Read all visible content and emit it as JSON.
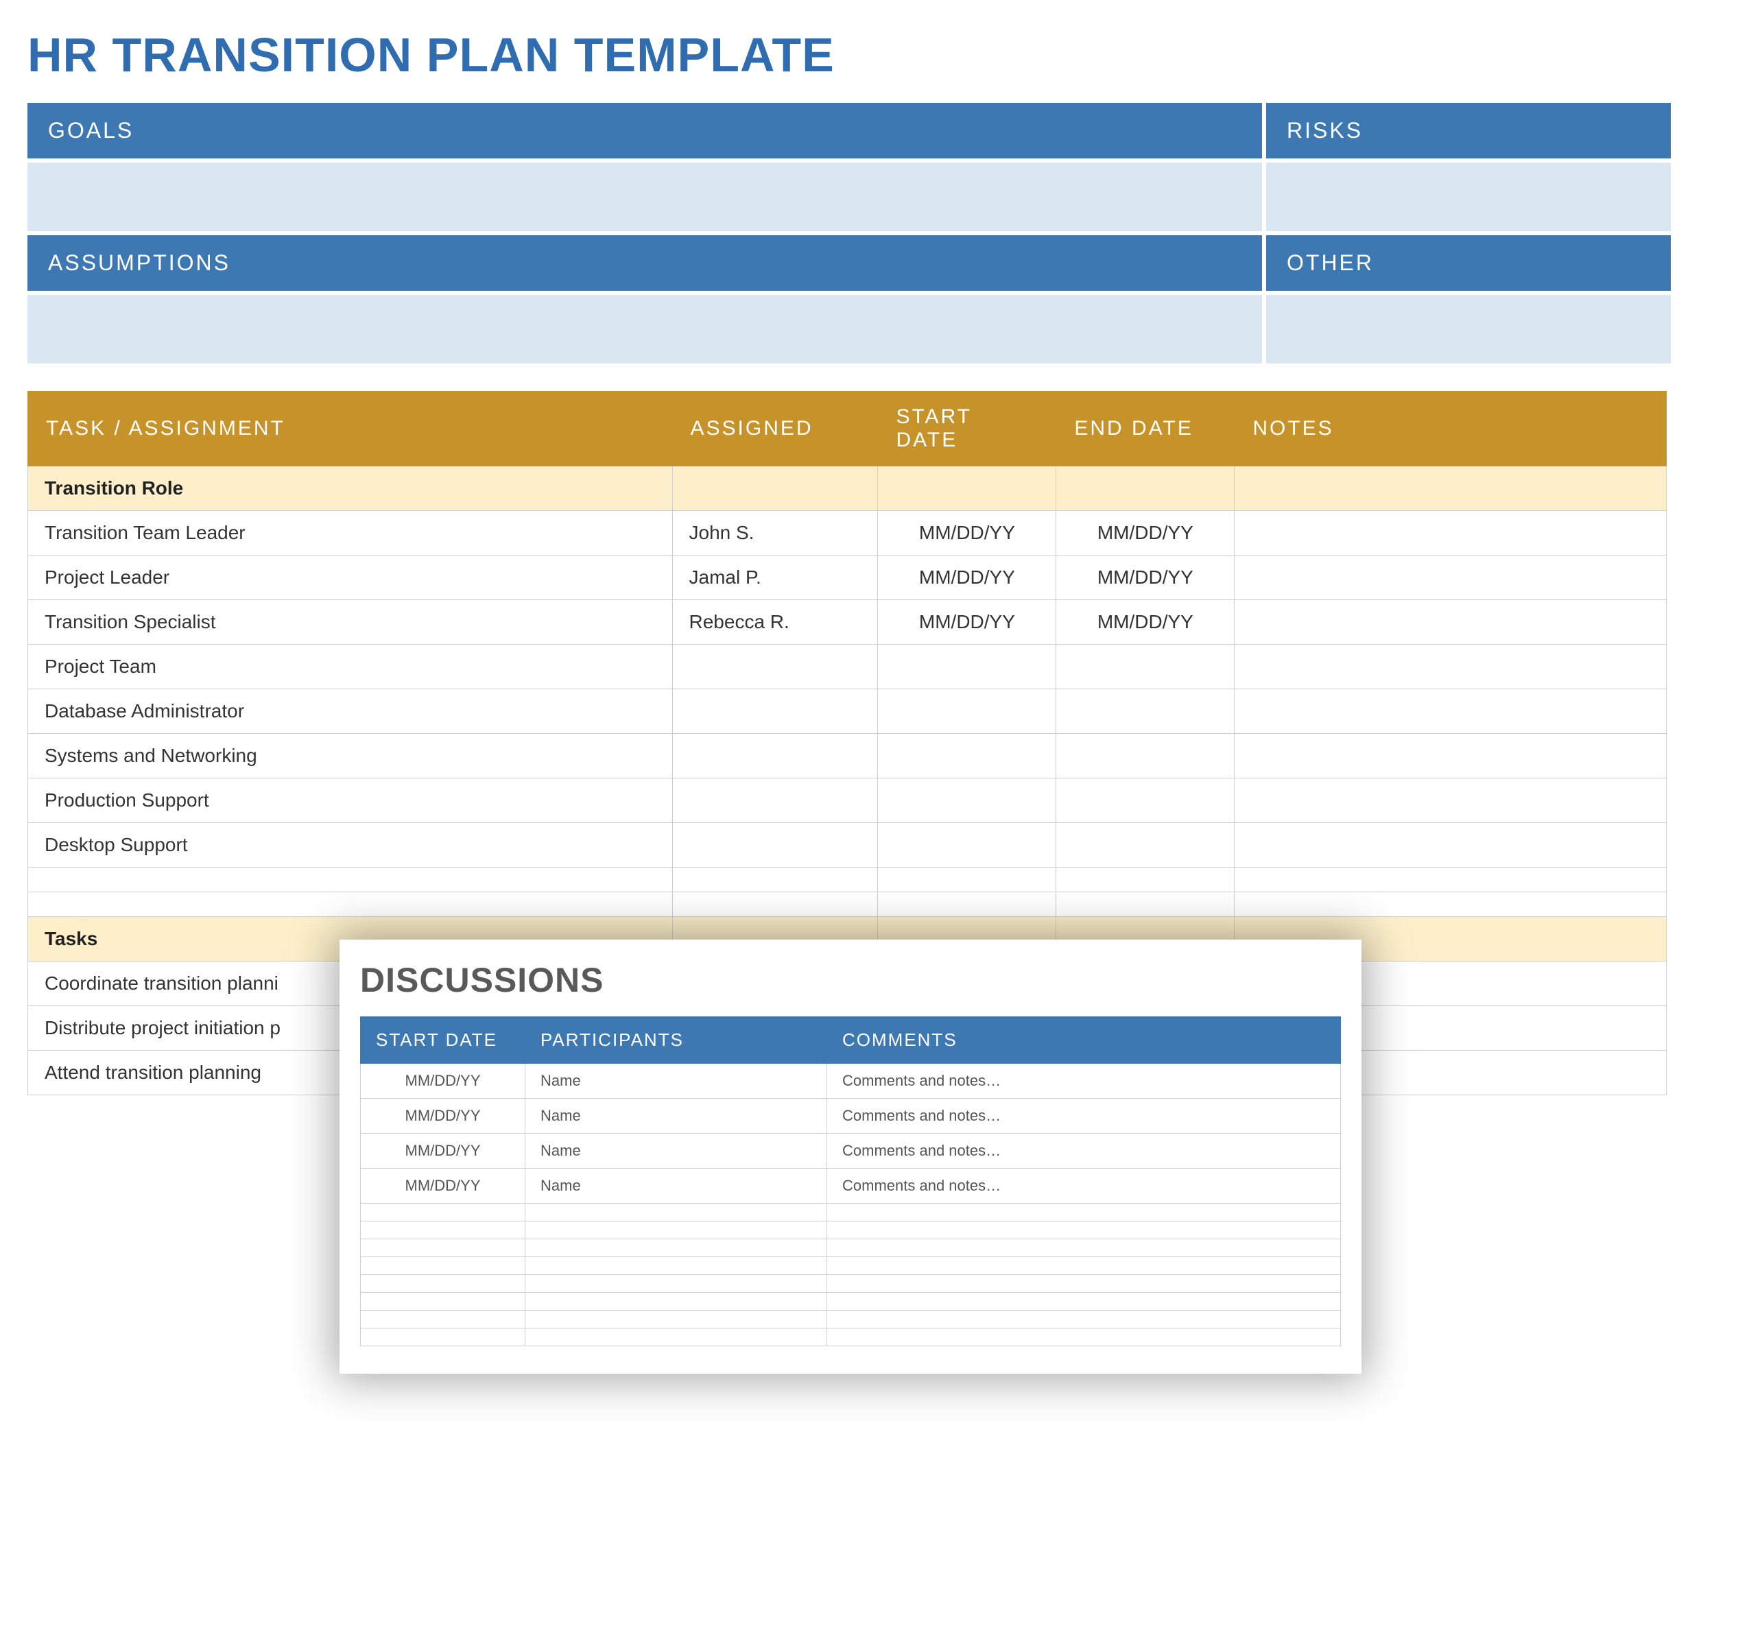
{
  "title": "HR TRANSITION PLAN TEMPLATE",
  "top": {
    "goals_label": "GOALS",
    "risks_label": "RISKS",
    "assumptions_label": "ASSUMPTIONS",
    "other_label": "OTHER",
    "goals_value": "",
    "risks_value": "",
    "assumptions_value": "",
    "other_value": ""
  },
  "task_headers": {
    "task": "TASK / ASSIGNMENT",
    "assigned": "ASSIGNED",
    "start": "START DATE",
    "end": "END DATE",
    "notes": "NOTES"
  },
  "sections": {
    "role": "Transition Role",
    "tasks": "Tasks"
  },
  "role_rows": [
    {
      "task": "Transition Team Leader",
      "assigned": "John S.",
      "start": "MM/DD/YY",
      "end": "MM/DD/YY",
      "notes": ""
    },
    {
      "task": "Project Leader",
      "assigned": "Jamal P.",
      "start": "MM/DD/YY",
      "end": "MM/DD/YY",
      "notes": ""
    },
    {
      "task": "Transition Specialist",
      "assigned": "Rebecca R.",
      "start": "MM/DD/YY",
      "end": "MM/DD/YY",
      "notes": ""
    },
    {
      "task": "Project Team",
      "assigned": "",
      "start": "",
      "end": "",
      "notes": ""
    },
    {
      "task": "Database Administrator",
      "assigned": "",
      "start": "",
      "end": "",
      "notes": ""
    },
    {
      "task": "Systems and Networking",
      "assigned": "",
      "start": "",
      "end": "",
      "notes": ""
    },
    {
      "task": "Production Support",
      "assigned": "",
      "start": "",
      "end": "",
      "notes": ""
    },
    {
      "task": "Desktop Support",
      "assigned": "",
      "start": "",
      "end": "",
      "notes": ""
    },
    {
      "task": "",
      "assigned": "",
      "start": "",
      "end": "",
      "notes": ""
    },
    {
      "task": "",
      "assigned": "",
      "start": "",
      "end": "",
      "notes": ""
    }
  ],
  "task_rows": [
    {
      "task": "Coordinate transition planni",
      "assigned": "",
      "start": "",
      "end": "",
      "notes": ""
    },
    {
      "task": "Distribute project initiation p",
      "assigned": "",
      "start": "",
      "end": "",
      "notes": ""
    },
    {
      "task": "Attend transition planning",
      "assigned": "",
      "start": "",
      "end": "",
      "notes": ""
    }
  ],
  "discussions": {
    "title": "DISCUSSIONS",
    "headers": {
      "start": "START DATE",
      "participants": "PARTICIPANTS",
      "comments": "COMMENTS"
    },
    "rows": [
      {
        "start": "MM/DD/YY",
        "participants": "Name",
        "comments": "Comments and notes…"
      },
      {
        "start": "MM/DD/YY",
        "participants": "Name",
        "comments": "Comments and notes…"
      },
      {
        "start": "MM/DD/YY",
        "participants": "Name",
        "comments": "Comments and notes…"
      },
      {
        "start": "MM/DD/YY",
        "participants": "Name",
        "comments": "Comments and notes…"
      },
      {
        "start": "",
        "participants": "",
        "comments": ""
      },
      {
        "start": "",
        "participants": "",
        "comments": ""
      },
      {
        "start": "",
        "participants": "",
        "comments": ""
      },
      {
        "start": "",
        "participants": "",
        "comments": ""
      },
      {
        "start": "",
        "participants": "",
        "comments": ""
      },
      {
        "start": "",
        "participants": "",
        "comments": ""
      },
      {
        "start": "",
        "participants": "",
        "comments": ""
      },
      {
        "start": "",
        "participants": "",
        "comments": ""
      }
    ]
  }
}
